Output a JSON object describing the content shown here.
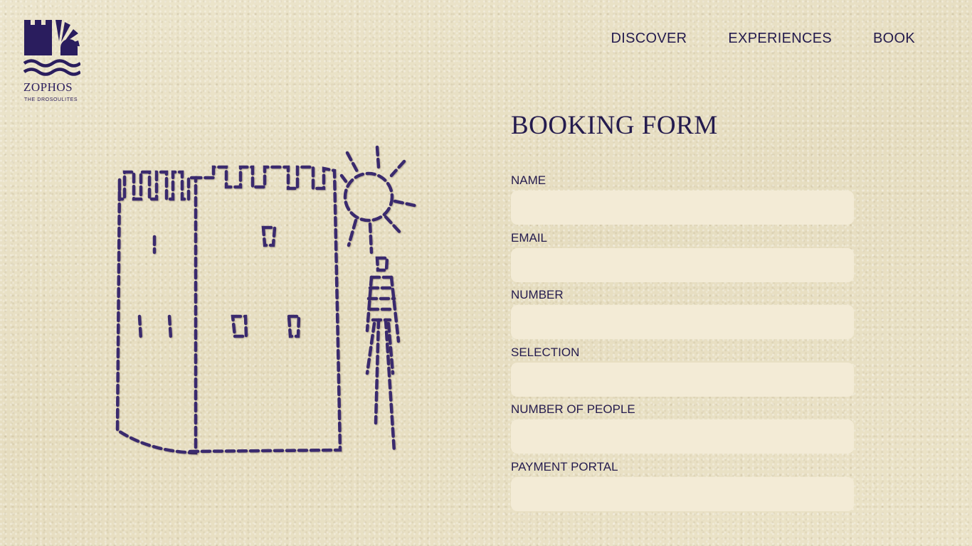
{
  "brand": {
    "name": "ZOPHOS",
    "tagline": "THE DROSOULITES",
    "logo_icon": "tower-sun-waves-logo",
    "color": "#2a1d5e"
  },
  "nav": {
    "items": [
      {
        "label": "DISCOVER"
      },
      {
        "label": "EXPERIENCES"
      },
      {
        "label": "BOOK"
      }
    ]
  },
  "illustration": {
    "icon": "stitched-tower-sun-skeleton-illustration",
    "stitch_color": "#3a2a6e"
  },
  "form": {
    "title": "BOOKING FORM",
    "fields": [
      {
        "label": "NAME",
        "value": ""
      },
      {
        "label": "EMAIL",
        "value": ""
      },
      {
        "label": "NUMBER",
        "value": ""
      },
      {
        "label": "SELECTION",
        "value": ""
      },
      {
        "label": "NUMBER OF PEOPLE",
        "value": ""
      },
      {
        "label": "PAYMENT PORTAL",
        "value": ""
      }
    ]
  },
  "colors": {
    "background": "#e9e1c5",
    "text": "#241b4e",
    "input_background": "#f3ebd6"
  }
}
